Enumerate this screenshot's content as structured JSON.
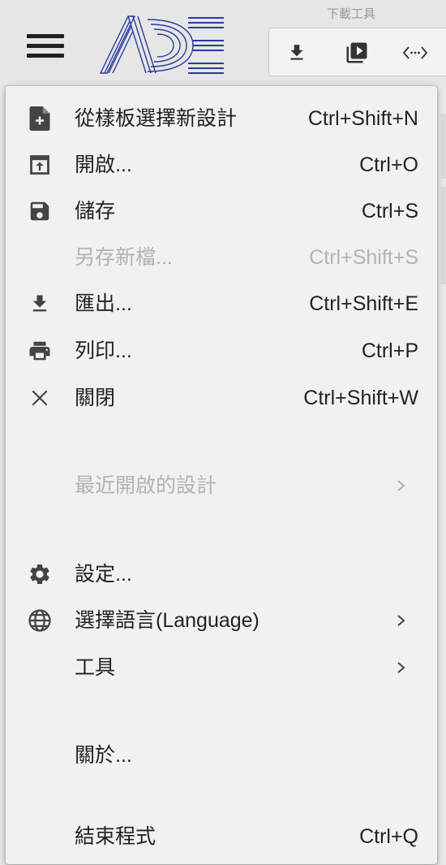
{
  "toolbar": {
    "download_tools_label": "下載工具",
    "buttons": [
      {
        "icon": "download-icon"
      },
      {
        "icon": "slideshow-icon"
      },
      {
        "icon": "embed-code-icon"
      }
    ]
  },
  "menu": {
    "items": [
      {
        "icon": "new-file-icon",
        "label": "從樣板選擇新設計",
        "shortcut": "Ctrl+Shift+N",
        "enabled": true
      },
      {
        "icon": "open-icon",
        "label": "開啟...",
        "shortcut": "Ctrl+O",
        "enabled": true
      },
      {
        "icon": "save-icon",
        "label": "儲存",
        "shortcut": "Ctrl+S",
        "enabled": true
      },
      {
        "icon": "",
        "label": "另存新檔...",
        "shortcut": "Ctrl+Shift+S",
        "enabled": false
      },
      {
        "icon": "export-icon",
        "label": "匯出...",
        "shortcut": "Ctrl+Shift+E",
        "enabled": true
      },
      {
        "icon": "print-icon",
        "label": "列印...",
        "shortcut": "Ctrl+P",
        "enabled": true
      },
      {
        "icon": "close-icon",
        "label": "關閉",
        "shortcut": "Ctrl+Shift+W",
        "enabled": true
      },
      {
        "icon": "",
        "label": "最近開啟的設計",
        "submenu": true,
        "enabled": false
      },
      {
        "icon": "gear-icon",
        "label": "設定...",
        "enabled": true
      },
      {
        "icon": "globe-icon",
        "label": "選擇語言(Language)",
        "submenu": true,
        "enabled": true
      },
      {
        "icon": "",
        "label": "工具",
        "submenu": true,
        "enabled": true
      },
      {
        "icon": "",
        "label": "關於...",
        "enabled": true
      },
      {
        "icon": "",
        "label": "結束程式",
        "shortcut": "Ctrl+Q",
        "enabled": true
      }
    ]
  }
}
